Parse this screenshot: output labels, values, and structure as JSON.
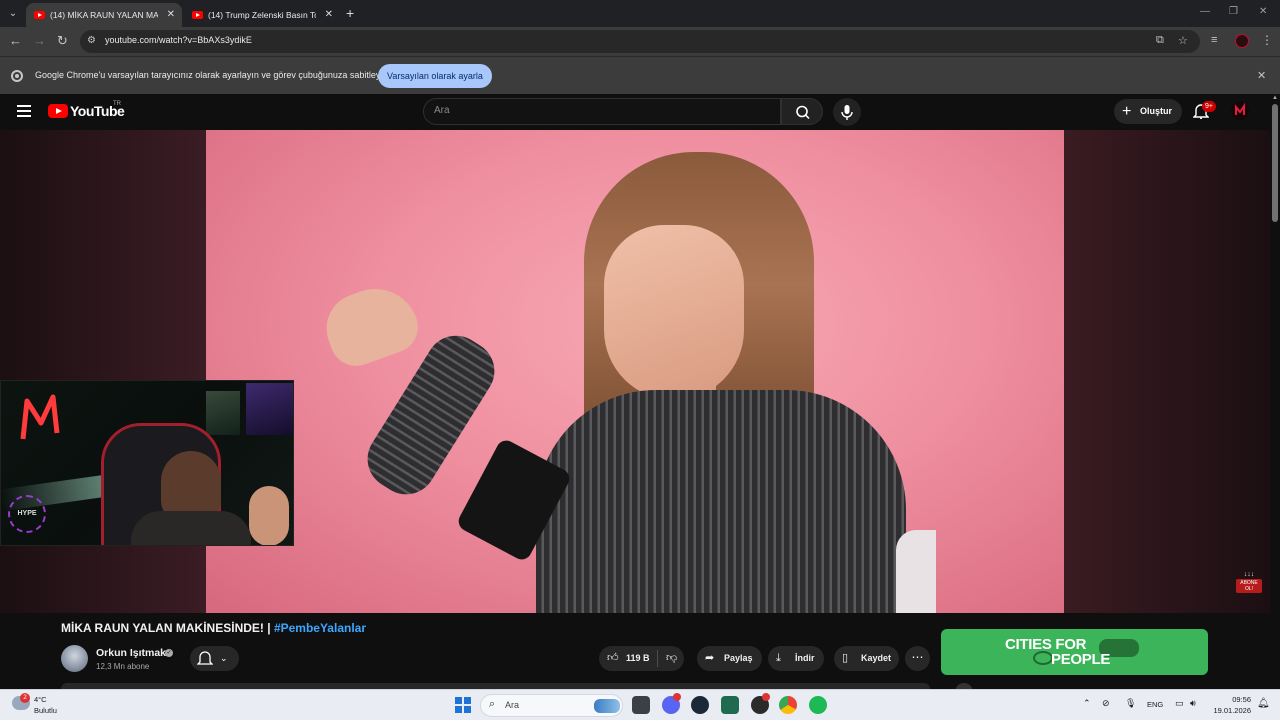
{
  "browser": {
    "tabs": [
      {
        "title": "(14) MİKA RAUN YALAN MAKİNESİNDE! | #PembeYalanlar - YouTube",
        "active": true
      },
      {
        "title": "(14) Trump Zelenski Basın Toplantısı",
        "active": false
      }
    ],
    "url": "youtube.com/watch?v=BbAXs3ydikE"
  },
  "infobar": {
    "message": "Google Chrome'u varsayılan tarayıcınız olarak ayarlayın ve görev çubuğunuza sabitleyin",
    "button_label": "Varsayılan olarak ayarla"
  },
  "youtube": {
    "logo_text": "YouTube",
    "country_code": "TR",
    "search_placeholder": "Ara",
    "create_label": "Oluştur",
    "notification_count": "9+"
  },
  "video": {
    "title": "MİKA RAUN YALAN MAKİNESİNDE! |",
    "hashtag": "#PembeYalanlar",
    "channel_name": "Orkun Işıtmak",
    "subscribers": "12,3 Mn abone",
    "like_count": "119 B",
    "share_label": "Paylaş",
    "download_label": "İndir",
    "save_label": "Kaydet",
    "overlay_hype": "HYPE",
    "overlay_subscribe": "ABONE OL!"
  },
  "ad": {
    "line1": "CITIES FOR",
    "line2": "PEOPLE"
  },
  "taskbar": {
    "weather_badge": "2",
    "temperature": "4°C",
    "weather_desc": "Bulutlu",
    "search_placeholder": "Ara",
    "language": "ENG",
    "time": "09:56",
    "date": "19.01.2026"
  }
}
